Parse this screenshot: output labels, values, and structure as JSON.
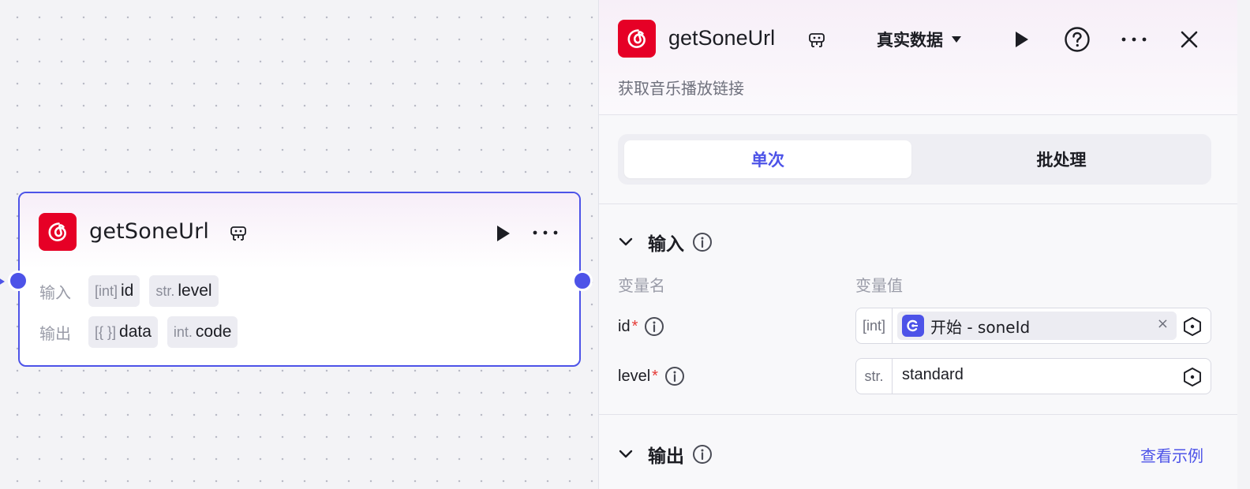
{
  "node": {
    "title": "getSoneUrl",
    "input_label": "输入",
    "output_label": "输出",
    "inputs": [
      {
        "type": "[int]",
        "name": "id"
      },
      {
        "type": "str.",
        "name": "level"
      }
    ],
    "outputs": [
      {
        "type": "[{ }]",
        "name": "data"
      },
      {
        "type": "int.",
        "name": "code"
      }
    ],
    "icons": [
      "netease-music-icon",
      "plugin-icon",
      "play-icon",
      "more-icon"
    ]
  },
  "panel": {
    "title": "getSoneUrl",
    "data_mode": "真实数据",
    "description": "获取音乐播放链接",
    "tabs": [
      "单次",
      "批处理"
    ],
    "input_section": {
      "title": "输入",
      "col_name": "变量名",
      "col_value": "变量值",
      "params": [
        {
          "name": "id",
          "required_mark": "*",
          "type": "[int]",
          "ref_value": "开始 - soneId",
          "clear": "×"
        },
        {
          "name": "level",
          "required_mark": "*",
          "type": "str.",
          "value": "standard"
        }
      ]
    },
    "output_section": {
      "title": "输出",
      "example_link": "查看示例"
    }
  },
  "colors": {
    "accent": "#4d53e8",
    "brand_red": "#e60026",
    "required": "#e53935"
  }
}
